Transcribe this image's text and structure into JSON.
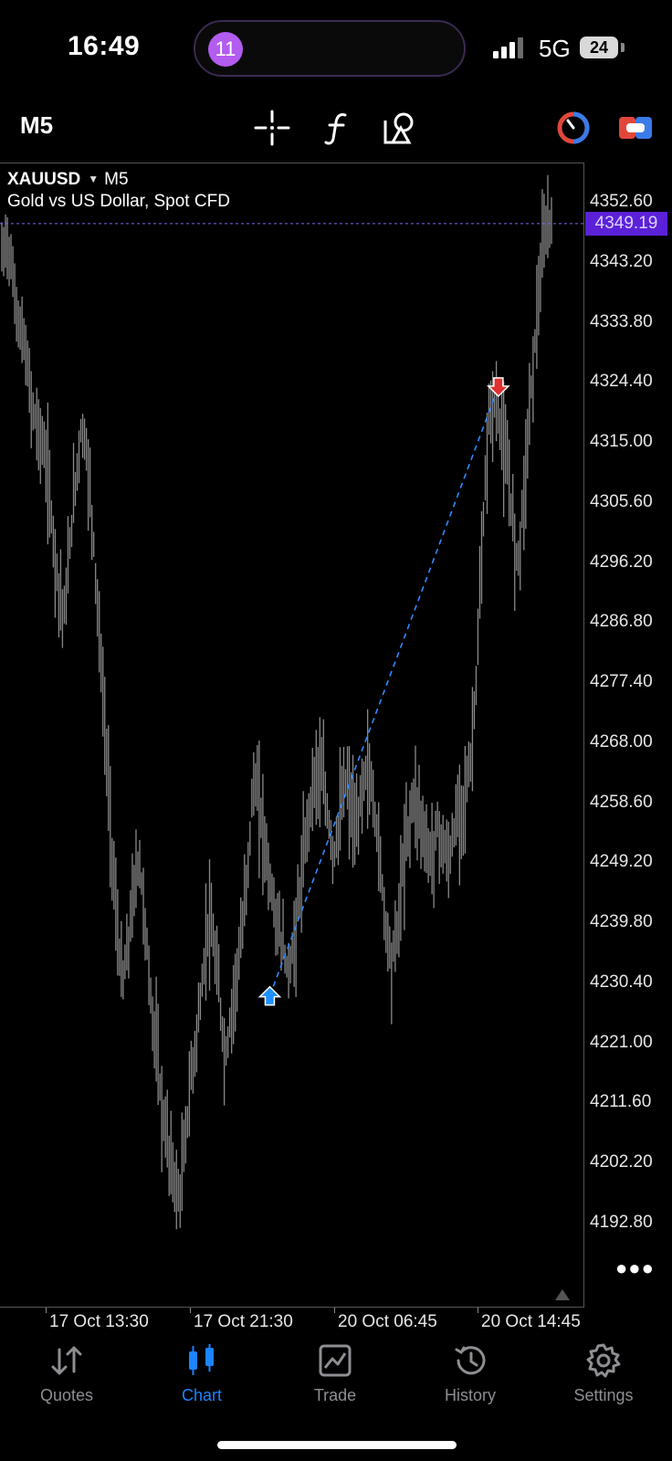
{
  "status_bar": {
    "time": "16:49",
    "notification_count": "11",
    "network": "5G",
    "battery": "24"
  },
  "toolbar": {
    "timeframe": "M5",
    "icons": [
      "crosshair-icon",
      "indicators-icon",
      "objects-icon",
      "signal-left-icon",
      "signal-right-icon"
    ]
  },
  "chart_header": {
    "symbol": "XAUUSD",
    "timeframe": "M5",
    "description": "Gold vs US Dollar, Spot CFD"
  },
  "colors": {
    "background": "#000000",
    "price_line": "#7b68ee",
    "current_price_box": "#5b21d9",
    "buy_arrow": "#1e90ff",
    "sell_arrow": "#e03030",
    "trade_line": "#2f8cff",
    "active_tab": "#1c84ff"
  },
  "chart_data": {
    "type": "line",
    "y_ticks": [
      "4352.60",
      "4343.20",
      "4333.80",
      "4324.40",
      "4315.00",
      "4305.60",
      "4296.20",
      "4286.80",
      "4277.40",
      "4268.00",
      "4258.60",
      "4249.20",
      "4239.80",
      "4230.40",
      "4221.00",
      "4211.60",
      "4202.20",
      "4192.80"
    ],
    "x_ticks": [
      "17 Oct 13:30",
      "17 Oct 21:30",
      "20 Oct 06:45",
      "20 Oct 14:45"
    ],
    "ylim": [
      4188,
      4358
    ],
    "current_price": "4349.19",
    "trade": {
      "entry": {
        "label": "buy",
        "price": 4228.3,
        "x_frac": 0.472
      },
      "exit": {
        "label": "sell",
        "price": 4323.6,
        "x_frac": 0.872
      }
    },
    "series": [
      {
        "values": [
          4344,
          4347,
          4340,
          4333,
          4330,
          4322,
          4318,
          4315,
          4310,
          4300,
          4292,
          4288,
          4300,
          4310,
          4318,
          4312,
          4300,
          4285,
          4270,
          4255,
          4240,
          4230,
          4235,
          4245,
          4250,
          4240,
          4228,
          4220,
          4210,
          4205,
          4200,
          4196,
          4205,
          4215,
          4222,
          4230,
          4240,
          4236,
          4228,
          4218,
          4225,
          4232,
          4238,
          4250,
          4262,
          4258,
          4252,
          4245,
          4240,
          4236,
          4232,
          4236,
          4244,
          4252,
          4260,
          4264,
          4262,
          4256,
          4250,
          4256,
          4262,
          4258,
          4253,
          4262,
          4264,
          4258,
          4250,
          4240,
          4234,
          4238,
          4248,
          4255,
          4260,
          4257,
          4252,
          4250,
          4255,
          4252,
          4249,
          4254,
          4258,
          4260,
          4266,
          4280,
          4300,
          4318,
          4322,
          4318,
          4312,
          4305,
          4296,
          4305,
          4318,
          4330,
          4340,
          4348,
          4350
        ]
      }
    ]
  },
  "bottom_nav": {
    "tabs": [
      {
        "label": "Quotes",
        "icon": "quotes-icon"
      },
      {
        "label": "Chart",
        "icon": "chart-icon"
      },
      {
        "label": "Trade",
        "icon": "trade-icon"
      },
      {
        "label": "History",
        "icon": "history-icon"
      },
      {
        "label": "Settings",
        "icon": "settings-icon"
      }
    ]
  }
}
